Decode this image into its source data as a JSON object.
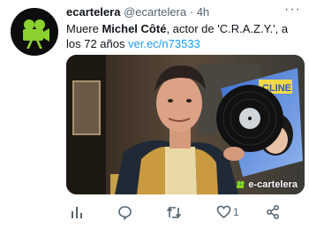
{
  "tweet": {
    "author_name": "ecartelera",
    "handle": "@ecartelera",
    "separator": "·",
    "time": "4h",
    "more": "···",
    "text_prefix": "Muere ",
    "text_bold": "Michel Côté",
    "text_suffix": ", actor de 'C.R.A.Z.Y.', a los 72 años ",
    "link": "ver.ec/n73533",
    "media_watermark": "e-cartelera",
    "record_label": "CLINE",
    "likes": "1"
  },
  "colors": {
    "link": "#1d9bf0",
    "muted": "#536471",
    "brand_green": "#7ed321"
  },
  "icons": {
    "avatar": "film-camera-logo",
    "views": "bar-chart-icon",
    "reply": "speech-bubble-icon",
    "retweet": "retweet-icon",
    "like": "heart-icon",
    "share": "share-icon"
  }
}
